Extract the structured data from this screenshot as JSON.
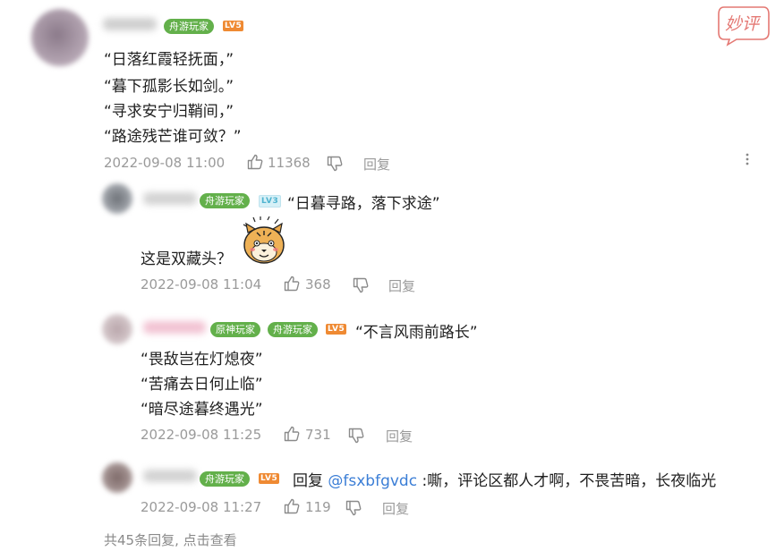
{
  "watermark": {
    "text": "妙评",
    "color": "#e47873"
  },
  "colors": {
    "badge_green": "#63b04b",
    "level_orange": "#ef8a33",
    "mention_blue": "#3b7ed6",
    "meta_gray": "#9a9a9a"
  },
  "comments": [
    {
      "badges": [
        "舟游玩家"
      ],
      "level": "LV5",
      "lines": [
        "“日落红霞轻抚面，”",
        "“暮下孤影长如剑。”",
        "“寻求安宁归鞘间，”",
        "“路途残芒谁可敛？”"
      ],
      "time": "2022-09-08 11:00",
      "likes": "11368",
      "reply_label": "回复",
      "icons": [
        "thumb-up-icon",
        "thumb-down-icon",
        "more-vertical-icon"
      ]
    }
  ],
  "replies": [
    {
      "badges": [
        "舟游玩家"
      ],
      "level": "LV3",
      "inline_text": "“日暮寻路，落下求途”",
      "lines": [
        "这是双藏头？"
      ],
      "sticker": "tiger-sticker-icon",
      "time": "2022-09-08 11:04",
      "likes": "368",
      "reply_label": "回复"
    },
    {
      "badges": [
        "原神玩家",
        "舟游玩家"
      ],
      "level": "LV5",
      "inline_text": "“不言风雨前路长”",
      "lines": [
        "“畏敌岂在灯熄夜”",
        "“苦痛去日何止临”",
        "“暗尽途暮终遇光”"
      ],
      "time": "2022-09-08 11:25",
      "likes": "731",
      "reply_label": "回复"
    },
    {
      "badges": [
        "舟游玩家"
      ],
      "level": "LV5",
      "inline_prefix": "回复 ",
      "mention": "@fsxbfgvdc",
      "inline_text": " :嘶，评论区都人才啊，不畏苦暗，长夜临光",
      "time": "2022-09-08 11:27",
      "likes": "119",
      "reply_label": "回复"
    }
  ],
  "footer": {
    "more_replies": "共45条回复, 点击查看"
  }
}
